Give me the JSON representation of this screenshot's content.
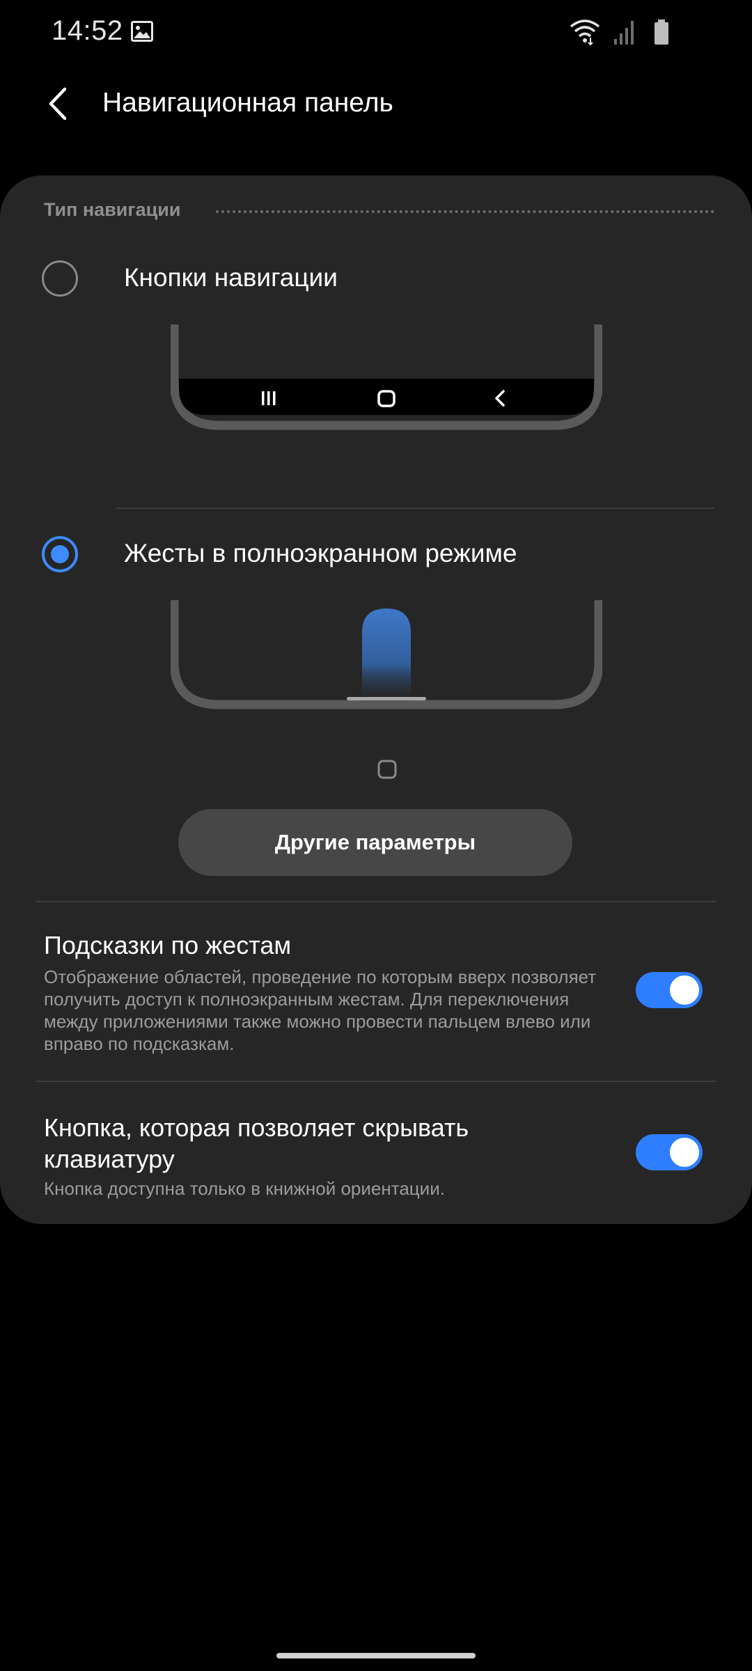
{
  "status_bar": {
    "time": "14:52",
    "icons": [
      "gallery-icon",
      "wifi-icon",
      "signal-icon",
      "battery-icon"
    ]
  },
  "app_bar": {
    "title": "Навигационная панель",
    "back_icon": "chevron-left-icon"
  },
  "navigation_type": {
    "header": "Тип навигации",
    "options": [
      {
        "label": "Кнопки навигации",
        "selected": false
      },
      {
        "label": "Жесты в полноэкранном режиме",
        "selected": true
      }
    ],
    "more_button_label": "Другие параметры"
  },
  "settings": [
    {
      "title": "Подсказки по жестам",
      "description": "Отображение областей, проведение по которым вверх позволяет получить доступ к полноэкранным жестам. Для переключения между приложениями также можно провести пальцем влево или вправо по подсказкам.",
      "enabled": true
    },
    {
      "title": "Кнопка, которая позволяет скрывать клавиатуру",
      "description": "Кнопка доступна только в книжной ориентации.",
      "enabled": true
    }
  ],
  "colors": {
    "accent": "#3e8bff",
    "card_background": "#262626",
    "background": "#000000"
  }
}
